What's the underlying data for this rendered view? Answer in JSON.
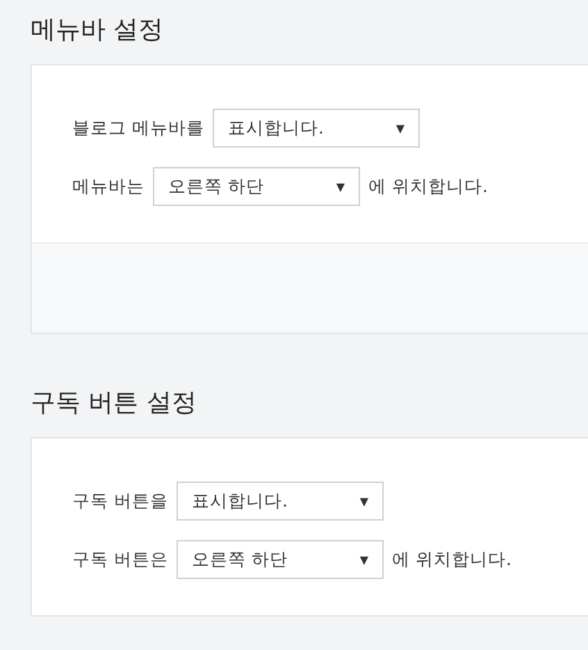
{
  "sections": [
    {
      "title": "메뉴바 설정",
      "footer_bar": true,
      "rows": [
        {
          "label": "블로그 메뉴바를",
          "value": "표시합니다.",
          "arrow": "▼"
        },
        {
          "label": "메뉴바는",
          "value": "오른쪽 하단",
          "arrow": "▼",
          "suffix": "에 위치합니다."
        }
      ]
    },
    {
      "title": "구독 버튼 설정",
      "footer_bar": false,
      "rows": [
        {
          "label": "구독 버튼을",
          "value": "표시합니다.",
          "arrow": "▼"
        },
        {
          "label": "구독 버튼은",
          "value": "오른쪽 하단",
          "arrow": "▼",
          "suffix": "에 위치합니다."
        }
      ]
    }
  ]
}
